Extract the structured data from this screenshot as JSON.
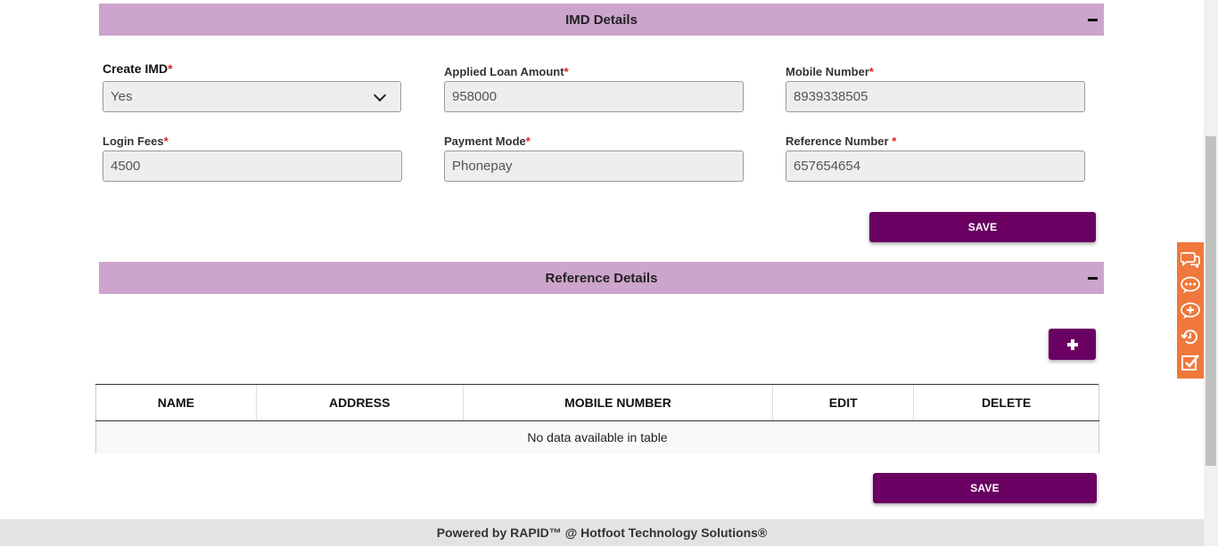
{
  "imd_section": {
    "title": "IMD Details",
    "fields": {
      "create_imd": {
        "label": "Create IMD",
        "required": "*",
        "value": "Yes"
      },
      "applied_loan_amount": {
        "label": "Applied Loan Amount",
        "required": "*",
        "value": "958000"
      },
      "mobile_number": {
        "label": "Mobile Number",
        "required": "*",
        "value": "8939338505"
      },
      "login_fees": {
        "label": "Login Fees",
        "required": "*",
        "value": "4500"
      },
      "payment_mode": {
        "label": "Payment Mode",
        "required": "*",
        "value": "Phonepay"
      },
      "reference_number": {
        "label": "Reference Number ",
        "required": "*",
        "value": "657654654"
      }
    },
    "save_label": "SAVE"
  },
  "reference_section": {
    "title": "Reference Details",
    "table": {
      "columns": [
        "NAME",
        "ADDRESS",
        "MOBILE NUMBER",
        "EDIT",
        "DELETE"
      ],
      "empty_message": "No data available in table"
    },
    "save_label": "SAVE"
  },
  "footer": {
    "text": "Powered by RAPID™ @ Hotfoot Technology Solutions®"
  },
  "side_toolbar": {
    "icons": [
      "chat-bubbles-icon",
      "comment-icon",
      "add-comment-icon",
      "history-icon",
      "checklist-icon"
    ]
  },
  "colors": {
    "section_header_bg": "#cca4cc",
    "primary_button": "#690062",
    "side_toolbar": "#f0783c",
    "required_mark": "#dd2222"
  }
}
